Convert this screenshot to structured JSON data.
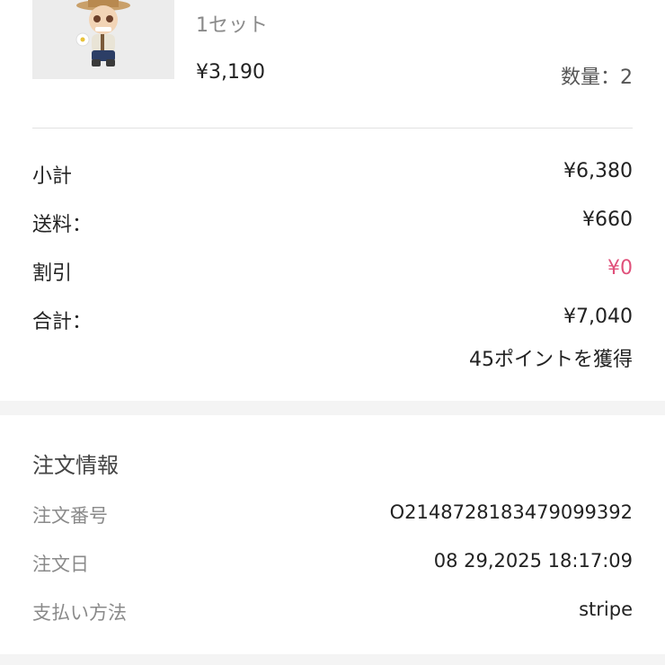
{
  "product": {
    "image_icon": "plush-doll-figure-icon",
    "variant": "1セット",
    "price": "¥3,190",
    "quantity": "数量：2"
  },
  "summary": {
    "subtotal": {
      "label": "小計",
      "value": "¥6,380"
    },
    "shipping": {
      "label": "送料：",
      "value": "¥660"
    },
    "discount": {
      "label": "割引",
      "value": "¥0"
    },
    "total": {
      "label": "合計：",
      "value": "¥7,040"
    },
    "points": "45ポイントを獲得"
  },
  "order_info": {
    "title": "注文情報",
    "order_number": {
      "label": "注文番号",
      "value": "O2148728183479099392"
    },
    "order_date": {
      "label": "注文日",
      "value": "08 29,2025 18:17:09"
    },
    "payment_method": {
      "label": "支払い方法",
      "value": "stripe"
    }
  },
  "colors": {
    "discount": "#e0507a",
    "background": "#f4f4f4",
    "card": "#ffffff"
  }
}
